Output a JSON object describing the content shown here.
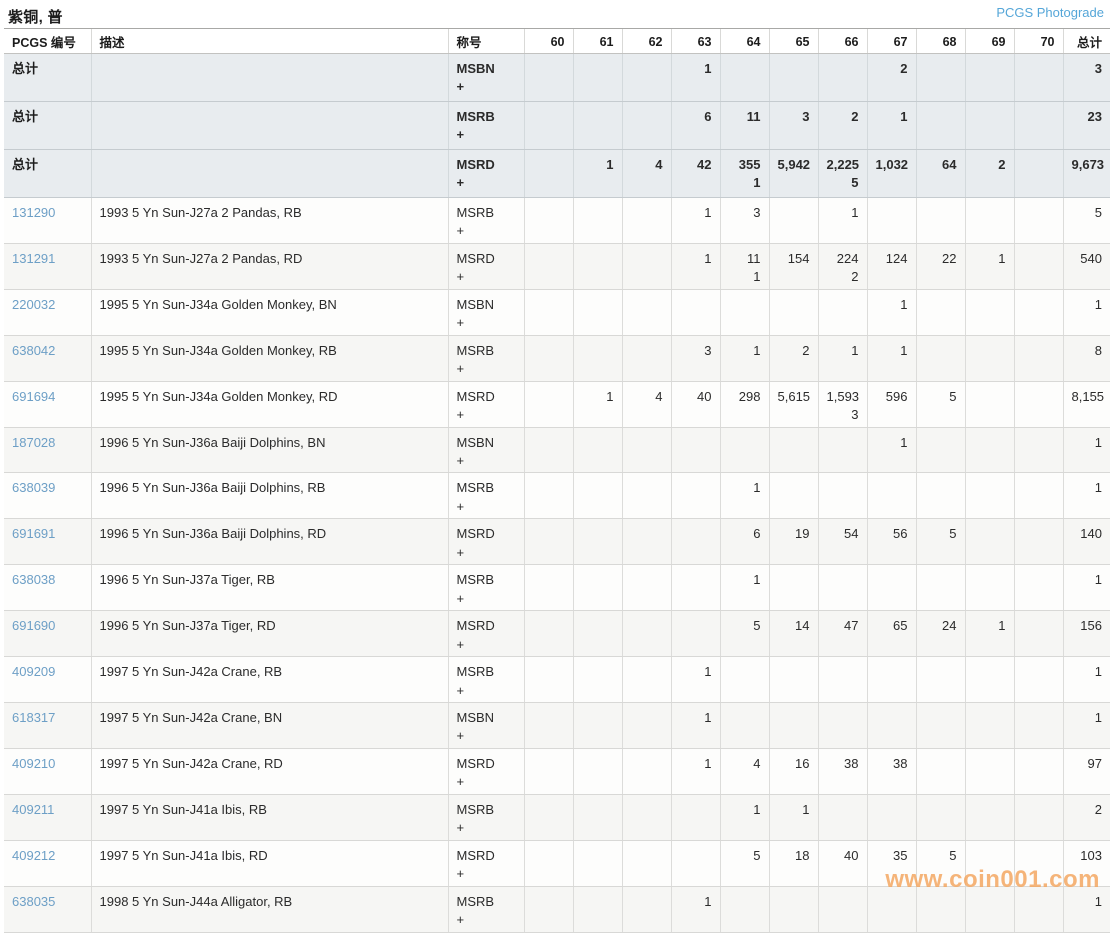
{
  "page": {
    "title": "紫铜, 普",
    "photograde_link": "PCGS Photograde",
    "watermark": "www.coin001.com"
  },
  "colors": {
    "accent_link": "#55a6d8",
    "pcgs_link": "#6d9fc6",
    "summary_row_bg": "#e8ecef",
    "alt_row_bg": "#f6f6f4",
    "watermark": "rgba(243,167,97,0.85)"
  },
  "table": {
    "headers": {
      "pcgs_no": "PCGS 编号",
      "description": "描述",
      "designation": "称号",
      "grades": [
        "60",
        "61",
        "62",
        "63",
        "64",
        "65",
        "66",
        "67",
        "68",
        "69",
        "70"
      ],
      "total": "总计"
    },
    "rows": [
      {
        "style": "summary",
        "pcgs_no": "总计",
        "description": "",
        "designation": "MSBN",
        "plus": "+",
        "cells": [
          [
            "",
            ""
          ],
          [
            "",
            ""
          ],
          [
            "",
            ""
          ],
          [
            "1",
            ""
          ],
          [
            "",
            ""
          ],
          [
            "",
            ""
          ],
          [
            "",
            ""
          ],
          [
            "2",
            ""
          ],
          [
            "",
            ""
          ],
          [
            "",
            ""
          ],
          [
            "",
            ""
          ]
        ],
        "total": "3"
      },
      {
        "style": "summary",
        "pcgs_no": "总计",
        "description": "",
        "designation": "MSRB",
        "plus": "+",
        "cells": [
          [
            "",
            ""
          ],
          [
            "",
            ""
          ],
          [
            "",
            ""
          ],
          [
            "6",
            ""
          ],
          [
            "11",
            ""
          ],
          [
            "3",
            ""
          ],
          [
            "2",
            ""
          ],
          [
            "1",
            ""
          ],
          [
            "",
            ""
          ],
          [
            "",
            ""
          ],
          [
            "",
            ""
          ]
        ],
        "total": "23"
      },
      {
        "style": "summary",
        "pcgs_no": "总计",
        "description": "",
        "designation": "MSRD",
        "plus": "+",
        "cells": [
          [
            "",
            ""
          ],
          [
            "1",
            ""
          ],
          [
            "4",
            ""
          ],
          [
            "42",
            ""
          ],
          [
            "355",
            "1"
          ],
          [
            "5,942",
            ""
          ],
          [
            "2,225",
            "5"
          ],
          [
            "1,032",
            ""
          ],
          [
            "64",
            ""
          ],
          [
            "2",
            ""
          ],
          [
            "",
            ""
          ]
        ],
        "total": "9,673"
      },
      {
        "style": "data",
        "pcgs_no": "131290",
        "description": "1993 5 Yn Sun-J27a 2 Pandas, RB",
        "designation": "MSRB",
        "plus": "+",
        "cells": [
          [
            "",
            ""
          ],
          [
            "",
            ""
          ],
          [
            "",
            ""
          ],
          [
            "1",
            ""
          ],
          [
            "3",
            ""
          ],
          [
            "",
            ""
          ],
          [
            "1",
            ""
          ],
          [
            "",
            ""
          ],
          [
            "",
            ""
          ],
          [
            "",
            ""
          ],
          [
            "",
            ""
          ]
        ],
        "total": "5"
      },
      {
        "style": "data",
        "pcgs_no": "131291",
        "description": "1993 5 Yn Sun-J27a 2 Pandas, RD",
        "designation": "MSRD",
        "plus": "+",
        "cells": [
          [
            "",
            ""
          ],
          [
            "",
            ""
          ],
          [
            "",
            ""
          ],
          [
            "1",
            ""
          ],
          [
            "11",
            "1"
          ],
          [
            "154",
            ""
          ],
          [
            "224",
            "2"
          ],
          [
            "124",
            ""
          ],
          [
            "22",
            ""
          ],
          [
            "1",
            ""
          ],
          [
            "",
            ""
          ]
        ],
        "total": "540"
      },
      {
        "style": "data",
        "pcgs_no": "220032",
        "description": "1995 5 Yn Sun-J34a Golden Monkey, BN",
        "designation": "MSBN",
        "plus": "+",
        "cells": [
          [
            "",
            ""
          ],
          [
            "",
            ""
          ],
          [
            "",
            ""
          ],
          [
            "",
            ""
          ],
          [
            "",
            ""
          ],
          [
            "",
            ""
          ],
          [
            "",
            ""
          ],
          [
            "1",
            ""
          ],
          [
            "",
            ""
          ],
          [
            "",
            ""
          ],
          [
            "",
            ""
          ]
        ],
        "total": "1"
      },
      {
        "style": "data",
        "pcgs_no": "638042",
        "description": "1995 5 Yn Sun-J34a Golden Monkey, RB",
        "designation": "MSRB",
        "plus": "+",
        "cells": [
          [
            "",
            ""
          ],
          [
            "",
            ""
          ],
          [
            "",
            ""
          ],
          [
            "3",
            ""
          ],
          [
            "1",
            ""
          ],
          [
            "2",
            ""
          ],
          [
            "1",
            ""
          ],
          [
            "1",
            ""
          ],
          [
            "",
            ""
          ],
          [
            "",
            ""
          ],
          [
            "",
            ""
          ]
        ],
        "total": "8"
      },
      {
        "style": "data",
        "pcgs_no": "691694",
        "description": "1995 5 Yn Sun-J34a Golden Monkey, RD",
        "designation": "MSRD",
        "plus": "+",
        "cells": [
          [
            "",
            ""
          ],
          [
            "1",
            ""
          ],
          [
            "4",
            ""
          ],
          [
            "40",
            ""
          ],
          [
            "298",
            ""
          ],
          [
            "5,615",
            ""
          ],
          [
            "1,593",
            "3"
          ],
          [
            "596",
            ""
          ],
          [
            "5",
            ""
          ],
          [
            "",
            ""
          ],
          [
            "",
            ""
          ]
        ],
        "total": "8,155"
      },
      {
        "style": "data",
        "pcgs_no": "187028",
        "description": "1996 5 Yn Sun-J36a Baiji Dolphins, BN",
        "designation": "MSBN",
        "plus": "+",
        "cells": [
          [
            "",
            ""
          ],
          [
            "",
            ""
          ],
          [
            "",
            ""
          ],
          [
            "",
            ""
          ],
          [
            "",
            ""
          ],
          [
            "",
            ""
          ],
          [
            "",
            ""
          ],
          [
            "1",
            ""
          ],
          [
            "",
            ""
          ],
          [
            "",
            ""
          ],
          [
            "",
            ""
          ]
        ],
        "total": "1"
      },
      {
        "style": "data",
        "pcgs_no": "638039",
        "description": "1996 5 Yn Sun-J36a Baiji Dolphins, RB",
        "designation": "MSRB",
        "plus": "+",
        "cells": [
          [
            "",
            ""
          ],
          [
            "",
            ""
          ],
          [
            "",
            ""
          ],
          [
            "",
            ""
          ],
          [
            "1",
            ""
          ],
          [
            "",
            ""
          ],
          [
            "",
            ""
          ],
          [
            "",
            ""
          ],
          [
            "",
            ""
          ],
          [
            "",
            ""
          ],
          [
            "",
            ""
          ]
        ],
        "total": "1"
      },
      {
        "style": "data",
        "pcgs_no": "691691",
        "description": "1996 5 Yn Sun-J36a Baiji Dolphins, RD",
        "designation": "MSRD",
        "plus": "+",
        "cells": [
          [
            "",
            ""
          ],
          [
            "",
            ""
          ],
          [
            "",
            ""
          ],
          [
            "",
            ""
          ],
          [
            "6",
            ""
          ],
          [
            "19",
            ""
          ],
          [
            "54",
            ""
          ],
          [
            "56",
            ""
          ],
          [
            "5",
            ""
          ],
          [
            "",
            ""
          ],
          [
            "",
            ""
          ]
        ],
        "total": "140"
      },
      {
        "style": "data",
        "pcgs_no": "638038",
        "description": "1996 5 Yn Sun-J37a Tiger, RB",
        "designation": "MSRB",
        "plus": "+",
        "cells": [
          [
            "",
            ""
          ],
          [
            "",
            ""
          ],
          [
            "",
            ""
          ],
          [
            "",
            ""
          ],
          [
            "1",
            ""
          ],
          [
            "",
            ""
          ],
          [
            "",
            ""
          ],
          [
            "",
            ""
          ],
          [
            "",
            ""
          ],
          [
            "",
            ""
          ],
          [
            "",
            ""
          ]
        ],
        "total": "1"
      },
      {
        "style": "data",
        "pcgs_no": "691690",
        "description": "1996 5 Yn Sun-J37a Tiger, RD",
        "designation": "MSRD",
        "plus": "+",
        "cells": [
          [
            "",
            ""
          ],
          [
            "",
            ""
          ],
          [
            "",
            ""
          ],
          [
            "",
            ""
          ],
          [
            "5",
            ""
          ],
          [
            "14",
            ""
          ],
          [
            "47",
            ""
          ],
          [
            "65",
            ""
          ],
          [
            "24",
            ""
          ],
          [
            "1",
            ""
          ],
          [
            "",
            ""
          ]
        ],
        "total": "156"
      },
      {
        "style": "data",
        "pcgs_no": "409209",
        "description": "1997 5 Yn Sun-J42a Crane, RB",
        "designation": "MSRB",
        "plus": "+",
        "cells": [
          [
            "",
            ""
          ],
          [
            "",
            ""
          ],
          [
            "",
            ""
          ],
          [
            "1",
            ""
          ],
          [
            "",
            ""
          ],
          [
            "",
            ""
          ],
          [
            "",
            ""
          ],
          [
            "",
            ""
          ],
          [
            "",
            ""
          ],
          [
            "",
            ""
          ],
          [
            "",
            ""
          ]
        ],
        "total": "1"
      },
      {
        "style": "data",
        "pcgs_no": "618317",
        "description": "1997 5 Yn Sun-J42a Crane, BN",
        "designation": "MSBN",
        "plus": "+",
        "cells": [
          [
            "",
            ""
          ],
          [
            "",
            ""
          ],
          [
            "",
            ""
          ],
          [
            "1",
            ""
          ],
          [
            "",
            ""
          ],
          [
            "",
            ""
          ],
          [
            "",
            ""
          ],
          [
            "",
            ""
          ],
          [
            "",
            ""
          ],
          [
            "",
            ""
          ],
          [
            "",
            ""
          ]
        ],
        "total": "1"
      },
      {
        "style": "data",
        "pcgs_no": "409210",
        "description": "1997 5 Yn Sun-J42a Crane, RD",
        "designation": "MSRD",
        "plus": "+",
        "cells": [
          [
            "",
            ""
          ],
          [
            "",
            ""
          ],
          [
            "",
            ""
          ],
          [
            "1",
            ""
          ],
          [
            "4",
            ""
          ],
          [
            "16",
            ""
          ],
          [
            "38",
            ""
          ],
          [
            "38",
            ""
          ],
          [
            "",
            ""
          ],
          [
            "",
            ""
          ],
          [
            "",
            ""
          ]
        ],
        "total": "97"
      },
      {
        "style": "data",
        "pcgs_no": "409211",
        "description": "1997 5 Yn Sun-J41a Ibis, RB",
        "designation": "MSRB",
        "plus": "+",
        "cells": [
          [
            "",
            ""
          ],
          [
            "",
            ""
          ],
          [
            "",
            ""
          ],
          [
            "",
            ""
          ],
          [
            "1",
            ""
          ],
          [
            "1",
            ""
          ],
          [
            "",
            ""
          ],
          [
            "",
            ""
          ],
          [
            "",
            ""
          ],
          [
            "",
            ""
          ],
          [
            "",
            ""
          ]
        ],
        "total": "2"
      },
      {
        "style": "data",
        "pcgs_no": "409212",
        "description": "1997 5 Yn Sun-J41a Ibis, RD",
        "designation": "MSRD",
        "plus": "+",
        "cells": [
          [
            "",
            ""
          ],
          [
            "",
            ""
          ],
          [
            "",
            ""
          ],
          [
            "",
            ""
          ],
          [
            "5",
            ""
          ],
          [
            "18",
            ""
          ],
          [
            "40",
            ""
          ],
          [
            "35",
            ""
          ],
          [
            "5",
            ""
          ],
          [
            "",
            ""
          ],
          [
            "",
            ""
          ]
        ],
        "total": "103"
      },
      {
        "style": "data",
        "pcgs_no": "638035",
        "description": "1998 5 Yn Sun-J44a Alligator, RB",
        "designation": "MSRB",
        "plus": "+",
        "cells": [
          [
            "",
            ""
          ],
          [
            "",
            ""
          ],
          [
            "",
            ""
          ],
          [
            "1",
            ""
          ],
          [
            "",
            ""
          ],
          [
            "",
            ""
          ],
          [
            "",
            ""
          ],
          [
            "",
            ""
          ],
          [
            "",
            ""
          ],
          [
            "",
            ""
          ],
          [
            "",
            ""
          ]
        ],
        "total": "1"
      }
    ]
  }
}
